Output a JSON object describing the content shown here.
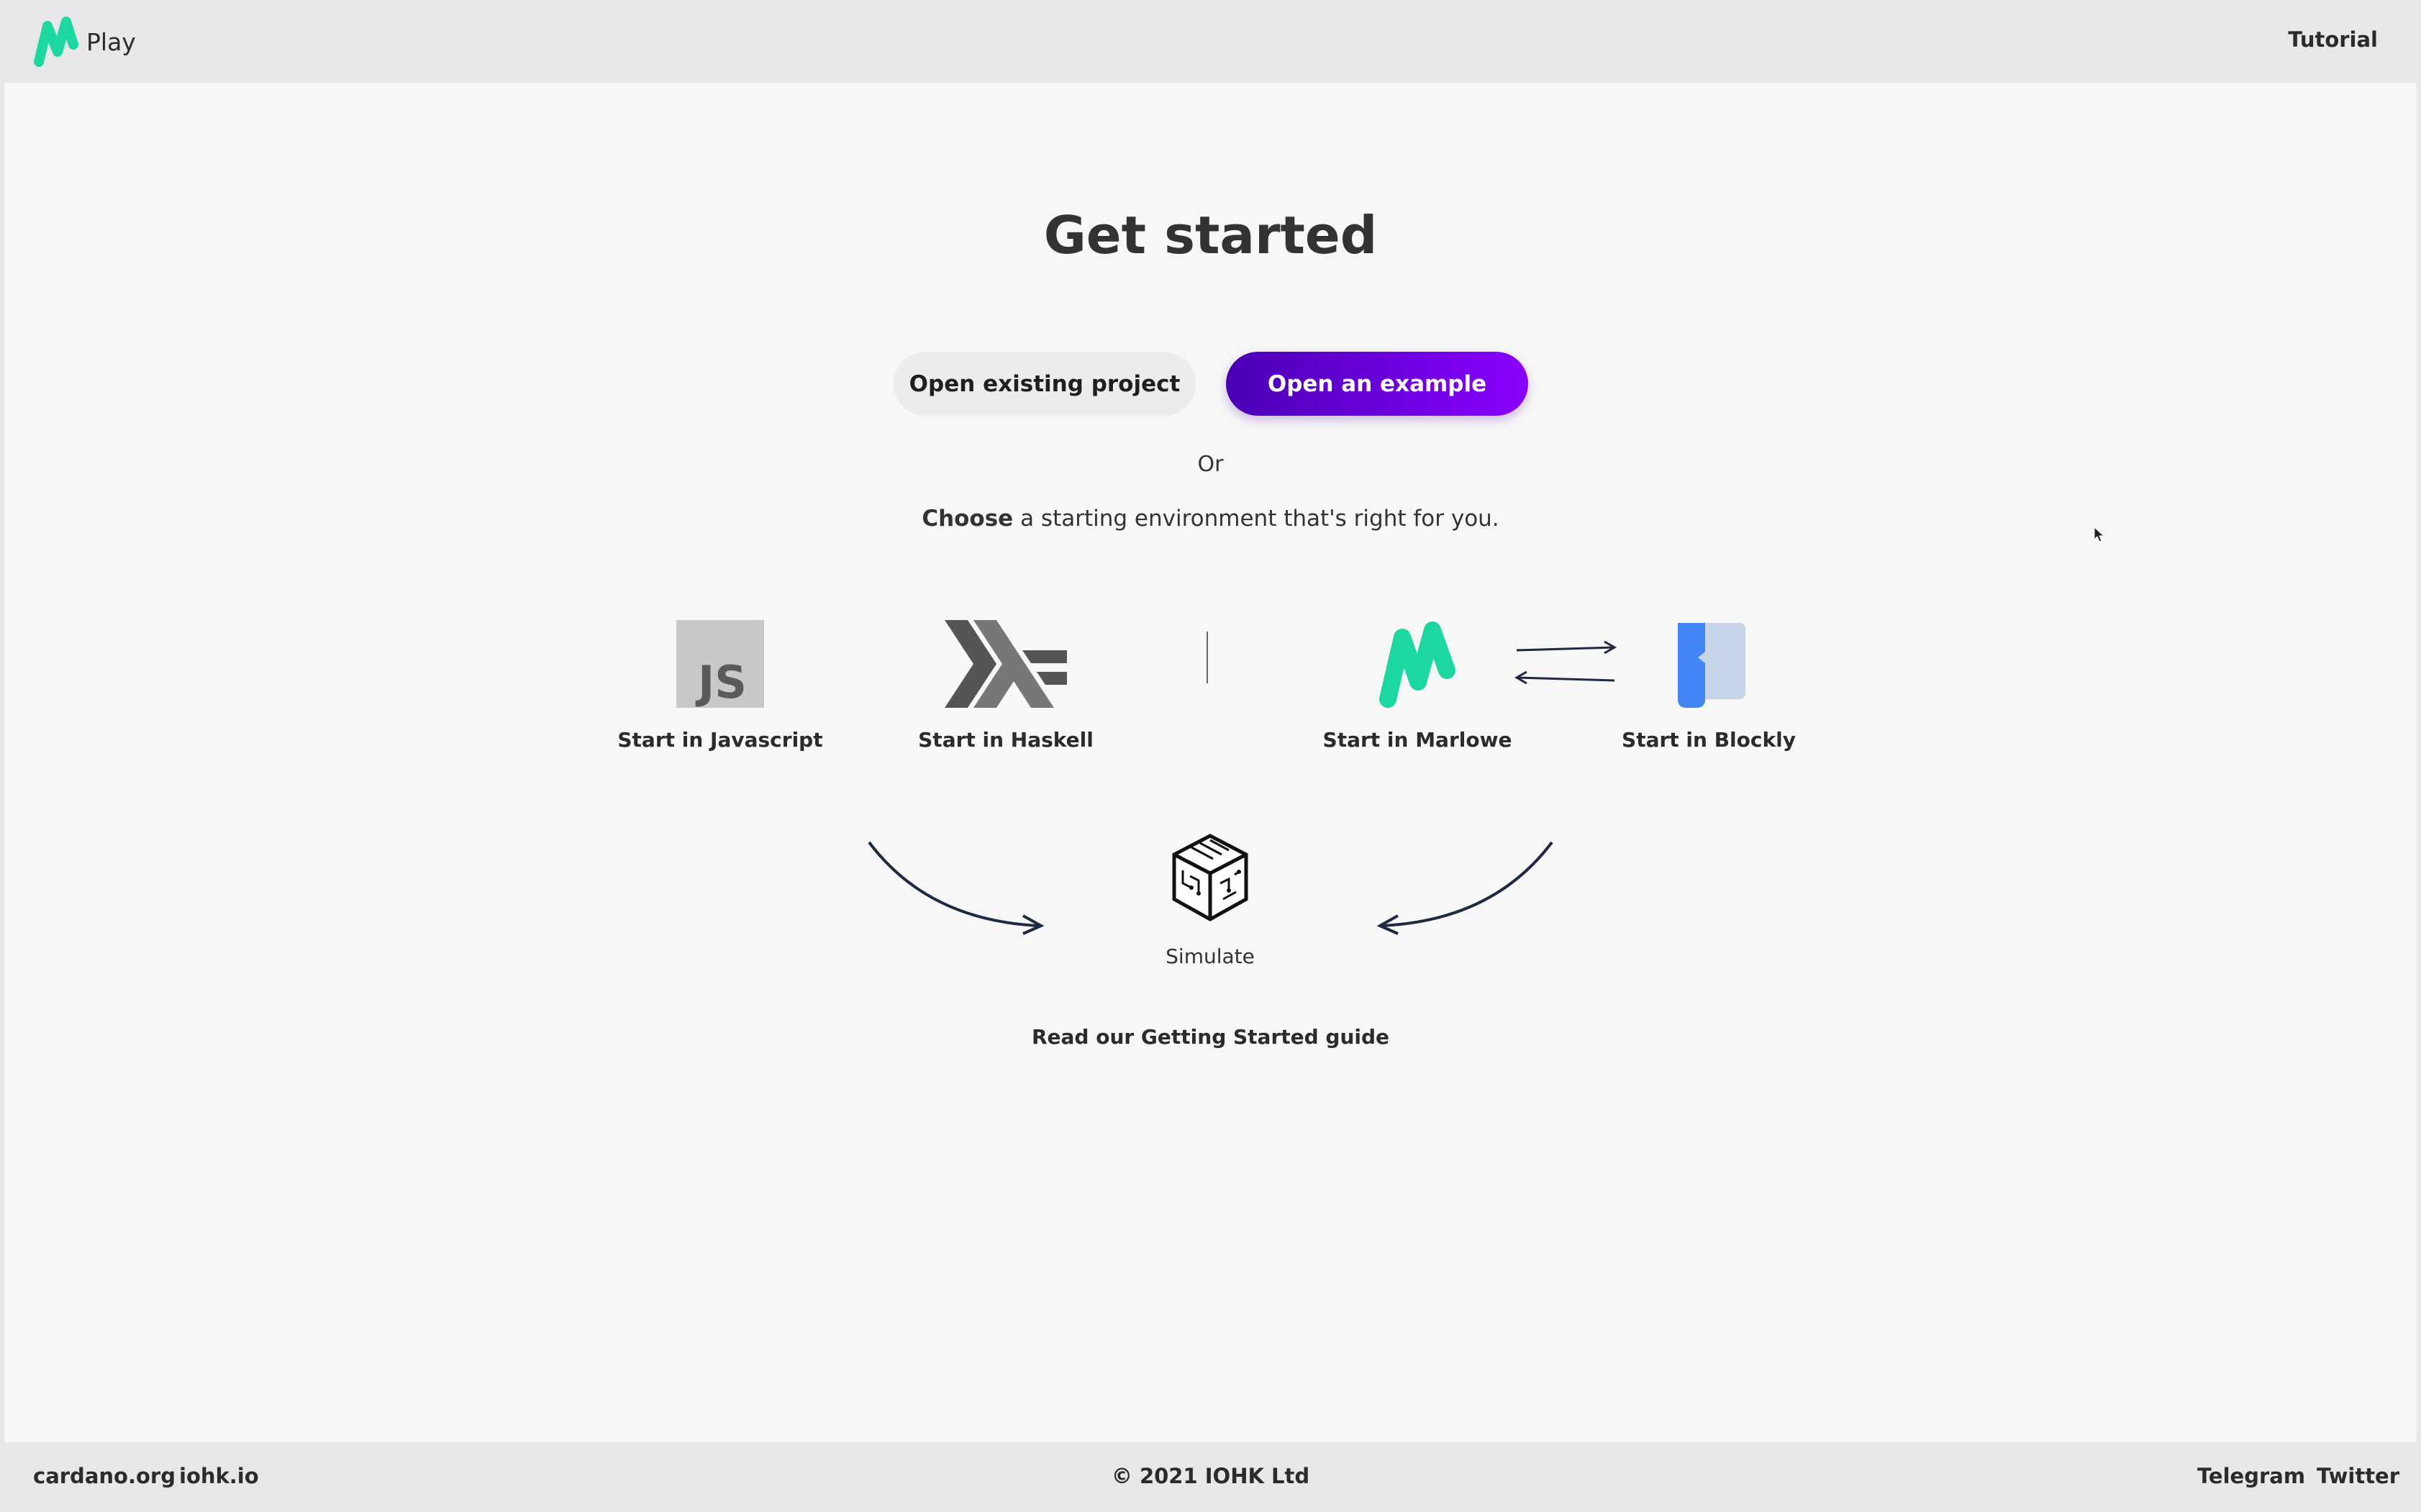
{
  "header": {
    "app_name": "Play",
    "tutorial_label": "Tutorial"
  },
  "main": {
    "title": "Get started",
    "open_project_label": "Open existing project",
    "open_example_label": "Open an example",
    "or_text": "Or",
    "choose_bold": "Choose",
    "choose_rest": " a starting environment that's right for you.",
    "environments": [
      {
        "label": "Start in Javascript",
        "icon": "javascript-icon"
      },
      {
        "label": "Start in Haskell",
        "icon": "haskell-icon"
      },
      {
        "label": "Start in Marlowe",
        "icon": "marlowe-icon"
      },
      {
        "label": "Start in Blockly",
        "icon": "blockly-icon"
      }
    ],
    "simulate_label": "Simulate",
    "guide_label": "Read our Getting Started guide"
  },
  "footer": {
    "links_left": [
      "cardano.org",
      "iohk.io"
    ],
    "copyright": "© 2021 IOHK Ltd",
    "links_right": [
      "Telegram",
      "Twitter"
    ]
  },
  "colors": {
    "brand_green": "#1cd8a0",
    "example_gradient_start": "#4a00b4",
    "example_gradient_end": "#8a00ff",
    "blockly_blue": "#4285f4"
  }
}
